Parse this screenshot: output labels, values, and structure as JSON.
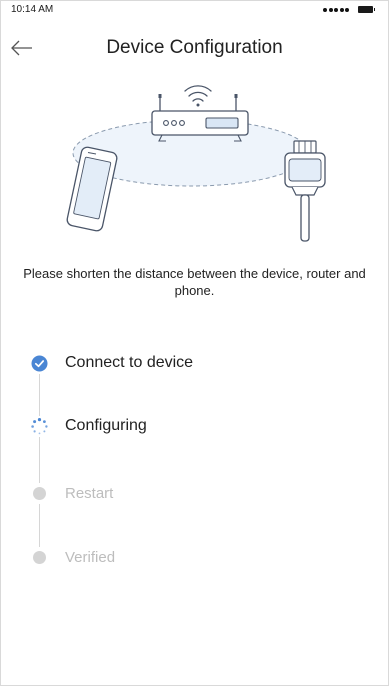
{
  "status_bar": {
    "time": "10:14 AM",
    "signal_icon": "signal-dots-icon",
    "battery_icon": "battery-icon"
  },
  "header": {
    "back_icon": "arrow-left-icon",
    "title": "Device Configuration"
  },
  "illustration": {
    "icons": [
      "router-icon",
      "wifi-icon",
      "phone-icon",
      "plug-device-icon"
    ]
  },
  "instruction": "Please shorten the distance between the device, router and phone.",
  "steps": [
    {
      "label": "Connect to device",
      "state": "done",
      "icon": "check-circle-icon"
    },
    {
      "label": "Configuring",
      "state": "in-progress",
      "icon": "spinner-icon"
    },
    {
      "label": "Restart",
      "state": "pending",
      "icon": "pending-dot-icon"
    },
    {
      "label": "Verified",
      "state": "pending",
      "icon": "pending-dot-icon"
    }
  ],
  "colors": {
    "accent": "#4a86d4",
    "pending": "#d4d4d4",
    "line": "#d6d6d6",
    "text": "#222222",
    "muted_text": "#bdbdbd"
  }
}
